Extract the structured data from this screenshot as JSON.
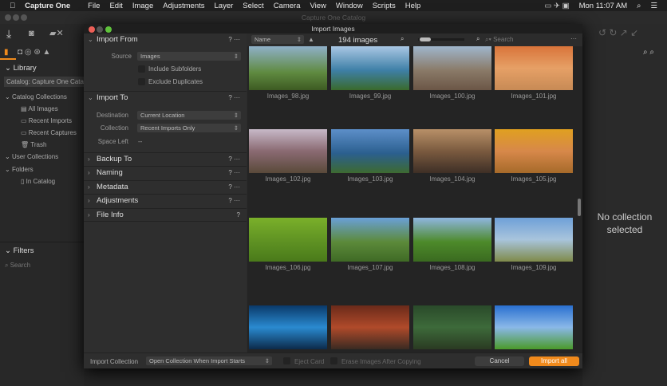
{
  "menubar": {
    "app": "Capture One",
    "items": [
      "File",
      "Edit",
      "Image",
      "Adjustments",
      "Layer",
      "Select",
      "Camera",
      "View",
      "Window",
      "Scripts",
      "Help"
    ],
    "clock": "Mon 11:07 AM"
  },
  "app_title": "Capture One Catalog",
  "library": {
    "title": "Library",
    "catalog": "Catalog: Capture One Catalog",
    "catalog_collections": "Catalog Collections",
    "items": [
      "All Images",
      "Recent Imports",
      "Recent Captures",
      "Trash"
    ],
    "user_collections": "User Collections",
    "folders": "Folders",
    "in_catalog": "In Catalog",
    "filters": "Filters",
    "search_placeholder": "Search"
  },
  "right_panel": {
    "message": "No collection selected"
  },
  "dialog": {
    "title": "Import Images",
    "import_from": {
      "title": "Import From",
      "source_label": "Source",
      "source_value": "Images",
      "include_subfolders": "Include Subfolders",
      "exclude_duplicates": "Exclude Duplicates"
    },
    "import_to": {
      "title": "Import To",
      "destination_label": "Destination",
      "destination_value": "Current Location",
      "collection_label": "Collection",
      "collection_value": "Recent Imports Only",
      "space_left_label": "Space Left",
      "space_left_value": "--"
    },
    "sections": [
      "Backup To",
      "Naming",
      "Metadata",
      "Adjustments",
      "File Info"
    ],
    "grid": {
      "sort": "Name",
      "count": "194 images",
      "search_placeholder": "Search",
      "images": [
        "Images_98.jpg",
        "Images_99.jpg",
        "Images_100.jpg",
        "Images_101.jpg",
        "Images_102.jpg",
        "Images_103.jpg",
        "Images_104.jpg",
        "Images_105.jpg",
        "Images_106.jpg",
        "Images_107.jpg",
        "Images_108.jpg",
        "Images_109.jpg",
        "",
        "",
        "",
        ""
      ]
    },
    "bottom": {
      "import_collection_label": "Import Collection",
      "import_collection_value": "Open Collection When Import Starts",
      "eject_card": "Eject Card",
      "erase_images": "Erase Images After Copying",
      "cancel": "Cancel",
      "import_all": "Import all"
    }
  },
  "colors": {
    "accent": "#f08a1c"
  }
}
